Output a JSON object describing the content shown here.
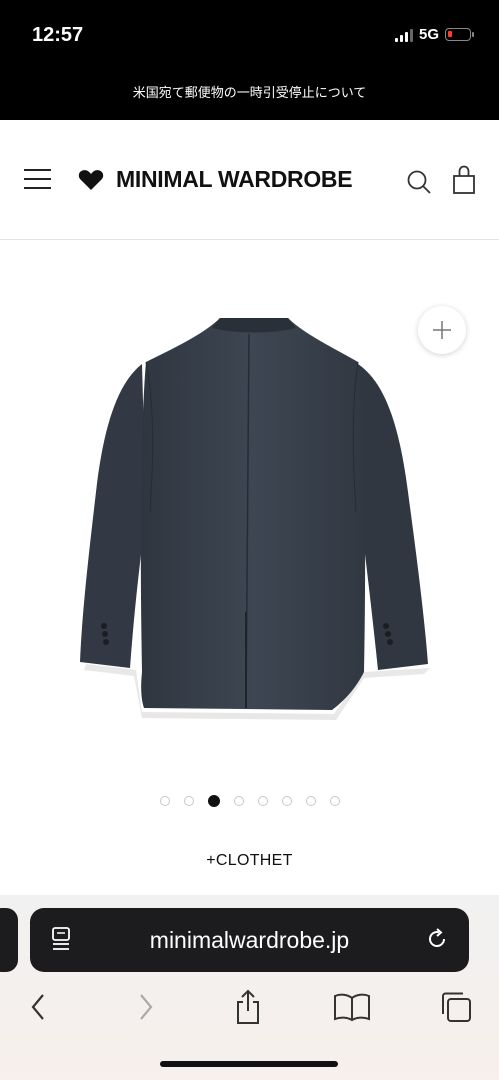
{
  "status_bar": {
    "time": "12:57",
    "network": "5G",
    "battery_level": 0.1,
    "battery_color": "#ff3b30"
  },
  "notice": {
    "text": "米国宛て郵便物の一時引受停止について"
  },
  "header": {
    "menu_icon": "hamburger-menu-icon",
    "logo_icon": "heart-icon",
    "logo_text": "MINIMAL WARDROBE",
    "search_icon": "search-icon",
    "cart_icon": "shopping-bag-icon"
  },
  "product": {
    "zoom_icon": "plus-icon",
    "image_description_icon": "jacket-back-image",
    "carousel": {
      "total": 8,
      "active_index": 2
    },
    "brand": "+CLOTHET"
  },
  "browser": {
    "url": "minimalwardrobe.jp",
    "reader_icon": "page-menu-icon",
    "reload_icon": "reload-icon",
    "toolbar": {
      "back_icon": "chevron-left-icon",
      "forward_icon": "chevron-right-icon",
      "share_icon": "share-icon",
      "bookmarks_icon": "book-icon",
      "tabs_icon": "tabs-icon"
    }
  },
  "colors": {
    "jacket": "#39414c",
    "accent": "#111111"
  }
}
